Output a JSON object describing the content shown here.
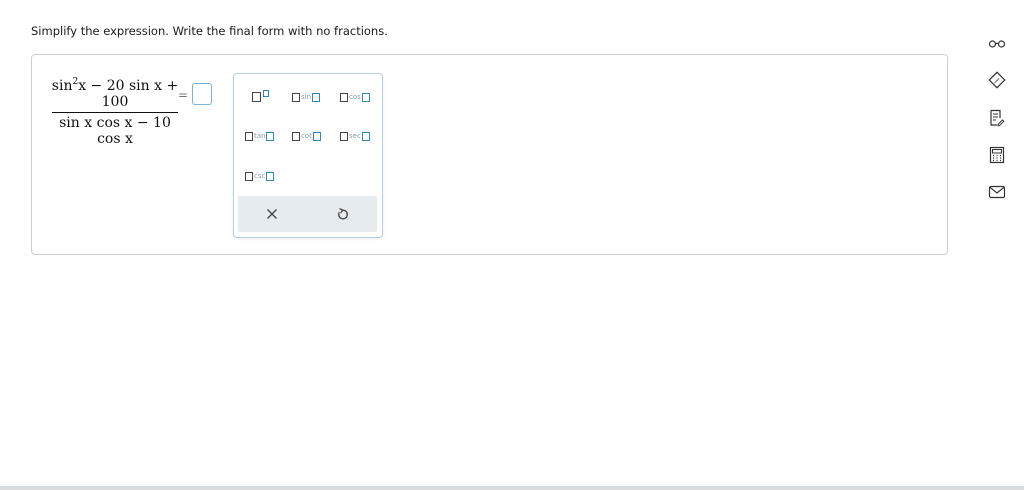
{
  "question": {
    "prompt": "Simplify the expression. Write the final form with no fractions."
  },
  "expression": {
    "numerator_a": "sin",
    "numerator_exp": "2",
    "numerator_b": "x − 20 sin x + 100",
    "denominator": "sin x cos x − 10 cos x",
    "equals": "="
  },
  "palette": {
    "keys": [
      {
        "name": "power",
        "label": ""
      },
      {
        "name": "sin",
        "label": "sin"
      },
      {
        "name": "cos",
        "label": "cos"
      },
      {
        "name": "tan",
        "label": "tan"
      },
      {
        "name": "cot",
        "label": "cot"
      },
      {
        "name": "sec",
        "label": "sec"
      },
      {
        "name": "csc",
        "label": "csc"
      }
    ],
    "clear_icon": "close-icon",
    "reset_icon": "undo-icon"
  },
  "right_toolbar": {
    "icons": [
      "glasses-icon",
      "pencil-diamond-icon",
      "notes-icon",
      "calculator-icon",
      "mail-icon"
    ]
  },
  "colors": {
    "accent": "#2e86c1",
    "toolbar_icon": "#333333",
    "palette_footer": "#e6ebef"
  }
}
